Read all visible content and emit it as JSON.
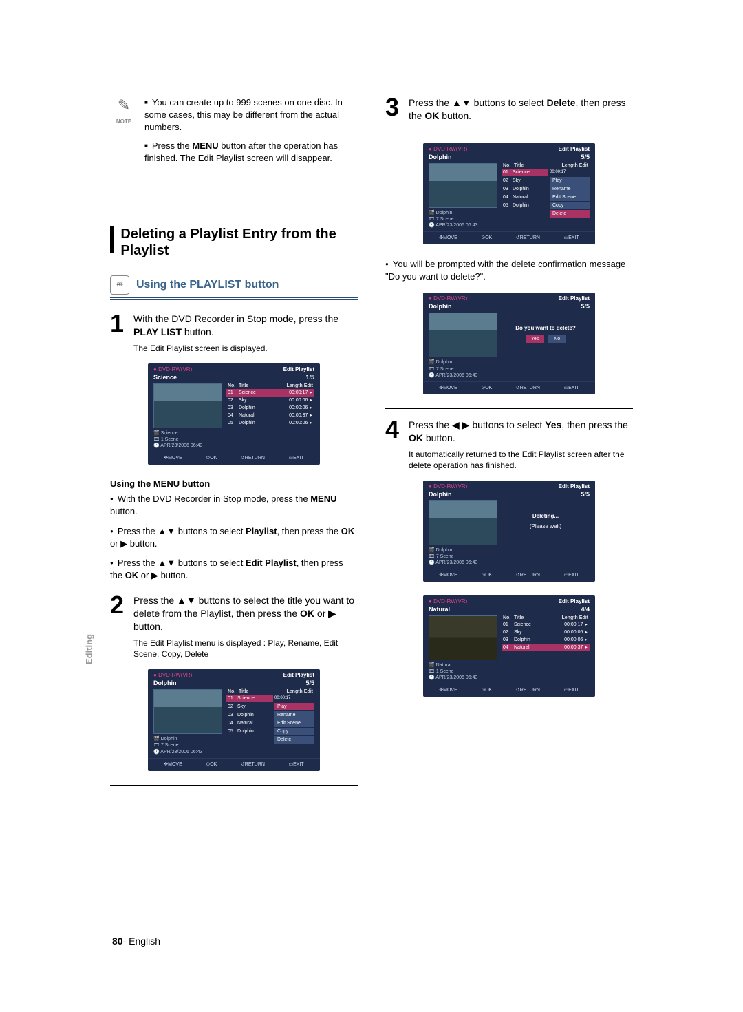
{
  "note": {
    "label": "NOTE",
    "items": [
      "You can create up to 999 scenes on one disc. In some cases, this may be different from the actual numbers.",
      "Press the MENU button after the operation has finished. The Edit Playlist screen will disappear."
    ]
  },
  "section": {
    "title": "Deleting a Playlist Entry from the Playlist"
  },
  "sub": {
    "title": "Using the PLAYLIST button"
  },
  "steps": {
    "s1": {
      "num": "1",
      "body": "With the DVD Recorder in Stop mode, press the PLAY LIST button.",
      "sub": "The Edit Playlist screen is displayed."
    },
    "s2": {
      "num": "2",
      "body": "Press the ▲▼ buttons to select the title you want to delete from the Playlist, then press the OK or ▶ button.",
      "sub": "The Edit Playlist menu is displayed : Play, Rename, Edit Scene, Copy, Delete"
    },
    "s3": {
      "num": "3",
      "body": "Press the ▲▼ buttons to select Delete, then press the OK button."
    },
    "s4": {
      "num": "4",
      "body": "Press the ◀ ▶ buttons to select Yes, then press the OK button.",
      "sub": "It automatically returned to the Edit Playlist screen after the delete operation has finished."
    }
  },
  "menu_section": {
    "head": "Using the MENU button",
    "items": [
      "With the DVD Recorder in Stop mode, press the MENU button.",
      "Press the ▲▼ buttons to select Playlist, then press the OK or ▶ button.",
      "Press the ▲▼ buttons to select Edit Playlist, then press the OK or ▶ button."
    ]
  },
  "confirm_text": "You will be prompted with the delete confirmation message \"Do you want to delete?\".",
  "ui": {
    "disc": "DVD-RW(VR)",
    "ep": "Edit Playlist",
    "footer": {
      "move": "MOVE",
      "ok": "OK",
      "return": "RETURN",
      "exit": "EXIT"
    },
    "scr1": {
      "title": "Science",
      "count": "1/5",
      "meta": [
        "Science",
        "1 Scene",
        "APR/23/2006 06:43"
      ],
      "head": {
        "no": "No.",
        "ti": "Title",
        "le": "Length Edit"
      },
      "rows": [
        {
          "no": "01",
          "ti": "Science",
          "le": "00:00:17"
        },
        {
          "no": "02",
          "ti": "Sky",
          "le": "00:00:06"
        },
        {
          "no": "03",
          "ti": "Dolphin",
          "le": "00:00:06"
        },
        {
          "no": "04",
          "ti": "Natural",
          "le": "00:00:37"
        },
        {
          "no": "05",
          "ti": "Dolphin",
          "le": "00:00:06"
        }
      ]
    },
    "scr2": {
      "title": "Dolphin",
      "count": "5/5",
      "meta": [
        "Dolphin",
        "7 Scene",
        "APR/23/2006 06:43"
      ],
      "rows": [
        {
          "no": "01",
          "ti": "Science",
          "le": "00:00:17",
          "sel": true,
          "opt": ""
        },
        {
          "no": "02",
          "ti": "Sky",
          "opt": "Play"
        },
        {
          "no": "03",
          "ti": "Dolphin",
          "opt": "Rename"
        },
        {
          "no": "04",
          "ti": "Natural",
          "opt": "Edit Scene"
        },
        {
          "no": "05",
          "ti": "Dolphin",
          "opt": "Copy"
        },
        {
          "no": "",
          "ti": "",
          "opt": "Delete"
        }
      ]
    },
    "scr3": {
      "title": "Dolphin",
      "count": "5/5",
      "meta": [
        "Dolphin",
        "7 Scene",
        "APR/23/2006 06:43"
      ],
      "rows": [
        {
          "no": "01",
          "ti": "Science",
          "le": "00:00:17",
          "sel": true,
          "opt": ""
        },
        {
          "no": "02",
          "ti": "Sky",
          "opt": "Play"
        },
        {
          "no": "03",
          "ti": "Dolphin",
          "opt": "Rename"
        },
        {
          "no": "04",
          "ti": "Natural",
          "opt": "Edit Scene"
        },
        {
          "no": "05",
          "ti": "Dolphin",
          "opt": "Copy"
        },
        {
          "no": "",
          "ti": "",
          "opt": "Delete",
          "optsel": true
        }
      ]
    },
    "scr4": {
      "title": "Dolphin",
      "count": "5/5",
      "meta": [
        "Dolphin",
        "7 Scene",
        "APR/23/2006 06:43"
      ],
      "msg": "Do you want to delete?",
      "yes": "Yes",
      "no": "No"
    },
    "scr5": {
      "title": "Dolphin",
      "count": "5/5",
      "meta": [
        "Dolphin",
        "7 Scene",
        "APR/23/2006 06:43"
      ],
      "msg1": "Deleting...",
      "msg2": "(Please wait)"
    },
    "scr6": {
      "title": "Natural",
      "count": "4/4",
      "meta": [
        "Natural",
        "1 Scene",
        "APR/23/2006 06:43"
      ],
      "head": {
        "no": "No.",
        "ti": "Title",
        "le": "Length Edit"
      },
      "rows": [
        {
          "no": "01",
          "ti": "Science",
          "le": "00:00:17"
        },
        {
          "no": "02",
          "ti": "Sky",
          "le": "00:00:06"
        },
        {
          "no": "03",
          "ti": "Dolphin",
          "le": "00:00:06"
        },
        {
          "no": "04",
          "ti": "Natural",
          "le": "00:00:37"
        }
      ]
    }
  },
  "side": "Editing",
  "footer": {
    "num": "80",
    "sep": "- ",
    "lang": "English"
  }
}
